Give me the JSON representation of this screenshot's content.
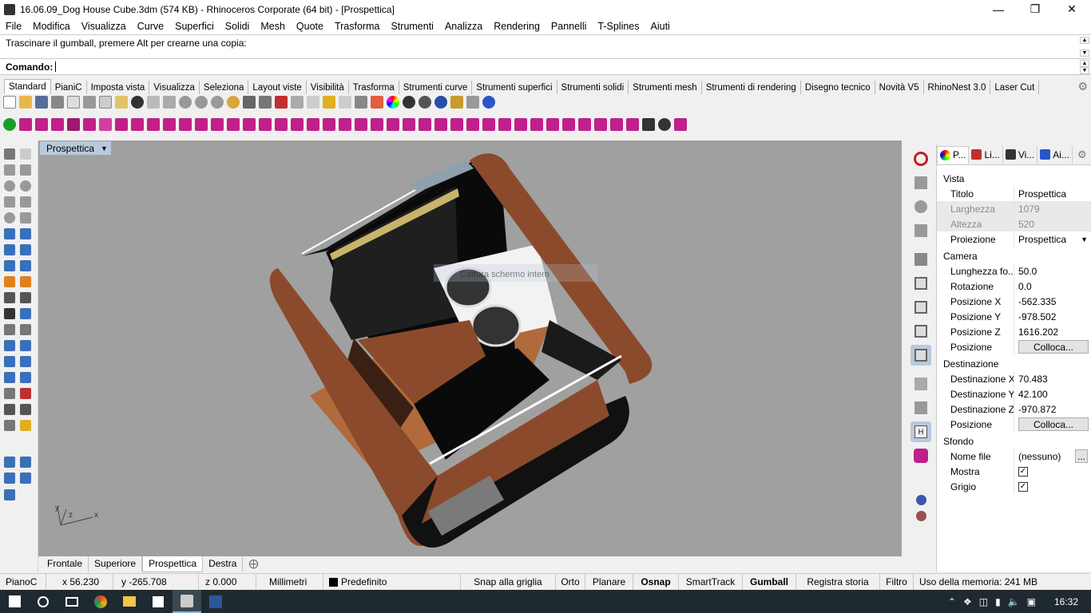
{
  "window": {
    "title": "16.06.09_Dog House Cube.3dm (574 KB) - Rhinoceros Corporate (64 bit) - [Prospettica]"
  },
  "menu": [
    "File",
    "Modifica",
    "Visualizza",
    "Curve",
    "Superfici",
    "Solidi",
    "Mesh",
    "Quote",
    "Trasforma",
    "Strumenti",
    "Analizza",
    "Rendering",
    "Pannelli",
    "T-Splines",
    "Aiuti"
  ],
  "command": {
    "history": "Trascinare il gumball, premere Alt per crearne una copia:",
    "prompt": "Comando:"
  },
  "toolbar_tabs": [
    "Standard",
    "PianiC",
    "Imposta vista",
    "Visualizza",
    "Seleziona",
    "Layout viste",
    "Visibilità",
    "Trasforma",
    "Strumenti curve",
    "Strumenti superfici",
    "Strumenti solidi",
    "Strumenti mesh",
    "Strumenti di rendering",
    "Disegno tecnico",
    "Novità V5",
    "RhinoNest 3.0",
    "Laser Cut"
  ],
  "viewport": {
    "title": "Prospettica",
    "overlay_text": "Cattura schermo intero",
    "axes": {
      "x": "x",
      "y": "y",
      "z": "z"
    }
  },
  "viewport_tabs": [
    "Frontale",
    "Superiore",
    "Prospettica",
    "Destra"
  ],
  "panel": {
    "tabs": [
      "P...",
      "Li...",
      "Vi...",
      "Ai..."
    ],
    "sections": {
      "vista": "Vista",
      "camera": "Camera",
      "destinazione": "Destinazione",
      "sfondo": "Sfondo"
    },
    "vista": [
      {
        "k": "Titolo",
        "v": "Prospettica"
      },
      {
        "k": "Larghezza",
        "v": "1079"
      },
      {
        "k": "Altezza",
        "v": "520"
      },
      {
        "k": "Proiezione",
        "v": "Prospettica"
      }
    ],
    "camera": [
      {
        "k": "Lunghezza fo...",
        "v": "50.0"
      },
      {
        "k": "Rotazione",
        "v": "0.0"
      },
      {
        "k": "Posizione X",
        "v": "-562.335"
      },
      {
        "k": "Posizione Y",
        "v": "-978.502"
      },
      {
        "k": "Posizione Z",
        "v": "1616.202"
      },
      {
        "k": "Posizione",
        "v": "Colloca..."
      }
    ],
    "destinazione": [
      {
        "k": "Destinazione X",
        "v": "70.483"
      },
      {
        "k": "Destinazione Y",
        "v": "42.100"
      },
      {
        "k": "Destinazione Z",
        "v": "-970.872"
      },
      {
        "k": "Posizione",
        "v": "Colloca..."
      }
    ],
    "sfondo": [
      {
        "k": "Nome file",
        "v": "(nessuno)"
      },
      {
        "k": "Mostra",
        "v": ""
      },
      {
        "k": "Grigio",
        "v": ""
      }
    ],
    "ellipsis": "..."
  },
  "status": {
    "plane": "PianoC",
    "x": "x 56.230",
    "y": "y -265.708",
    "z": "z 0.000",
    "units": "Millimetri",
    "layer": "Predefinito",
    "snap": "Snap alla griglia",
    "orto": "Orto",
    "planare": "Planare",
    "osnap": "Osnap",
    "smarttrack": "SmartTrack",
    "gumball": "Gumball",
    "registra": "Registra storia",
    "filtro": "Filtro",
    "memory": "Uso della memoria: 241 MB"
  },
  "taskbar": {
    "time": "16:32"
  },
  "colors": {
    "accent": "#b9c9dc",
    "wood": "#8b4a2b",
    "viewport_bg": "#a0a0a0"
  }
}
